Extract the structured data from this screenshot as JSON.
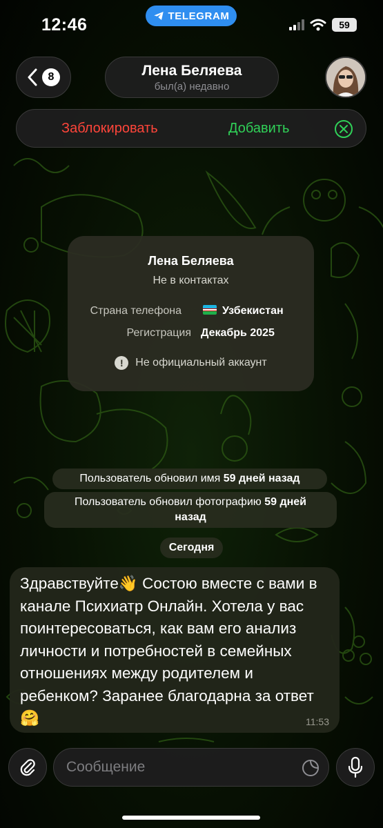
{
  "status_bar": {
    "time": "12:46",
    "app_pill": "TELEGRAM",
    "battery": "59"
  },
  "header": {
    "back_badge": "8",
    "contact_name": "Лена Беляева",
    "last_seen": "был(а) недавно"
  },
  "action_bar": {
    "block_label": "Заблокировать",
    "add_label": "Добавить"
  },
  "info_card": {
    "name": "Лена Беляева",
    "subtitle": "Не в контактах",
    "phone_country_label": "Страна телефона",
    "phone_country_value": "Узбекистан",
    "registration_label": "Регистрация",
    "registration_value": "Декабрь 2025",
    "note": "Не официальный аккаунт"
  },
  "service_messages": {
    "name_update_text": "Пользователь обновил имя ",
    "name_update_bold": "59 дней назад",
    "photo_update_text": "Пользователь обновил фотографию ",
    "photo_update_bold_1": "59 дней",
    "photo_update_bold_2": "назад",
    "date_separator": "Сегодня"
  },
  "message": {
    "text": "Здравствуйте👋 Состою вместе с вами в канале Психиатр Онлайн. Хотела у вас поинтересоваться, как вам его анализ личности и потребностей в семейных отношениях между родителем и ребенком? Заранее благодарна за ответ 🤗",
    "time": "11:53"
  },
  "input": {
    "placeholder": "Сообщение"
  },
  "colors": {
    "block": "#ff453a",
    "add": "#30d158",
    "telegram": "#2f8ef0"
  },
  "icons": [
    "back-chevron-icon",
    "paper-plane-icon",
    "close-icon",
    "warning-icon",
    "paperclip-icon",
    "sticker-icon",
    "microphone-icon"
  ]
}
